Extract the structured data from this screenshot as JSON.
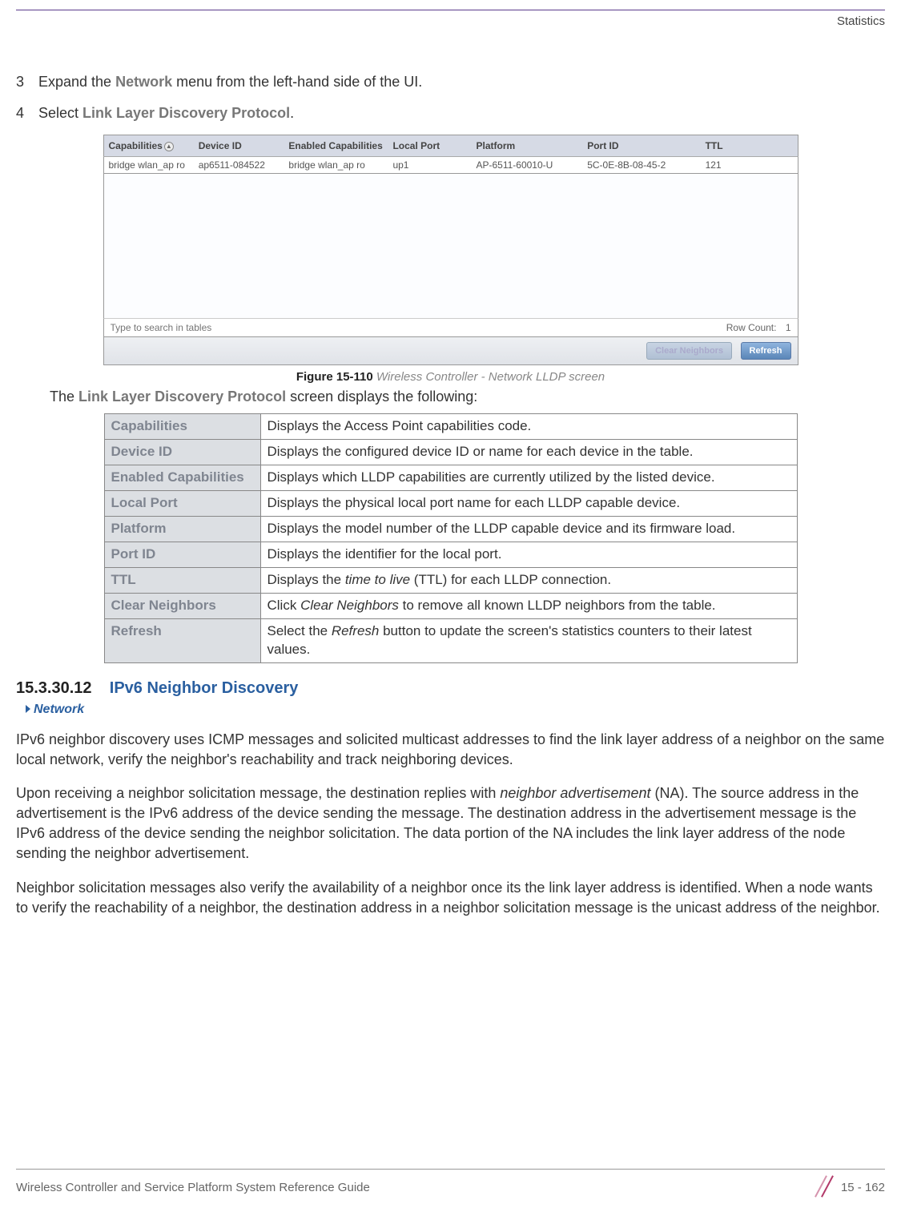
{
  "header": {
    "section": "Statistics"
  },
  "steps": [
    {
      "num": "3",
      "pre": "Expand the ",
      "bold": "Network",
      "post": " menu from the left-hand side of the UI."
    },
    {
      "num": "4",
      "pre": "Select ",
      "bold": "Link Layer Discovery Protocol",
      "post": "."
    }
  ],
  "lldp": {
    "columns": [
      "Capabilities",
      "Device ID",
      "Enabled Capabilities",
      "Local Port",
      "Platform",
      "Port ID",
      "TTL"
    ],
    "row": {
      "capabilities": "bridge wlan_ap ro",
      "device_id": "ap6511-084522",
      "enabled_caps": "bridge wlan_ap ro",
      "local_port": "up1",
      "platform": "AP-6511-60010-U",
      "port_id": "5C-0E-8B-08-45-2",
      "ttl": "121"
    },
    "search_placeholder": "Type to search in tables",
    "row_count_label": "Row Count:",
    "row_count_value": "1",
    "buttons": {
      "clear": "Clear Neighbors",
      "refresh": "Refresh"
    }
  },
  "figure": {
    "label": "Figure 15-110",
    "title": "Wireless Controller - Network LLDP screen"
  },
  "intro": {
    "pre": "The ",
    "bold": "Link Layer Discovery Protocol",
    "post": " screen displays the following:"
  },
  "defs": [
    {
      "term": "Capabilities",
      "desc": "Displays the Access Point capabilities code."
    },
    {
      "term": "Device ID",
      "desc": "Displays the configured device ID or name for each device in the table."
    },
    {
      "term": "Enabled Capabilities",
      "desc": "Displays which LLDP capabilities are currently utilized by the listed device."
    },
    {
      "term": "Local Port",
      "desc": "Displays the physical local port name for each LLDP capable device."
    },
    {
      "term": "Platform",
      "desc": "Displays the model number of the LLDP capable device and its firmware load."
    },
    {
      "term": "Port ID",
      "desc": "Displays the identifier for the local port."
    },
    {
      "term": "TTL",
      "desc_pre": "Displays the ",
      "desc_it": "time to live",
      "desc_post": " (TTL) for each LLDP connection."
    },
    {
      "term": "Clear Neighbors",
      "desc_pre": "Click ",
      "desc_it": "Clear Neighbors",
      "desc_post": " to remove all known LLDP neighbors from the table."
    },
    {
      "term": "Refresh",
      "desc_pre": "Select the ",
      "desc_it": "Refresh",
      "desc_post": " button to update the screen's statistics counters to their latest values."
    }
  ],
  "section": {
    "num": "15.3.30.12",
    "title": "IPv6 Neighbor Discovery",
    "breadcrumb": "Network"
  },
  "paras": {
    "p1": "IPv6 neighbor discovery uses ICMP messages and solicited multicast addresses to find the link layer address of a neighbor on the same local network, verify the neighbor's reachability and track neighboring devices.",
    "p2_pre": "Upon receiving a neighbor solicitation message, the destination replies with ",
    "p2_it": "neighbor advertisement",
    "p2_post": " (NA). The source address in the advertisement is the IPv6 address of the device sending the message. The destination address in the advertisement message is the IPv6 address of the device sending the neighbor solicitation. The data portion of the NA includes the link layer address of the node sending the neighbor advertisement.",
    "p3": "Neighbor solicitation messages also verify the availability of a neighbor once its the link layer address is identified. When a node wants to verify the reachability of a neighbor, the destination address in a neighbor solicitation message is the unicast address of the neighbor."
  },
  "footer": {
    "guide": "Wireless Controller and Service Platform System Reference Guide",
    "page": "15 - 162"
  }
}
